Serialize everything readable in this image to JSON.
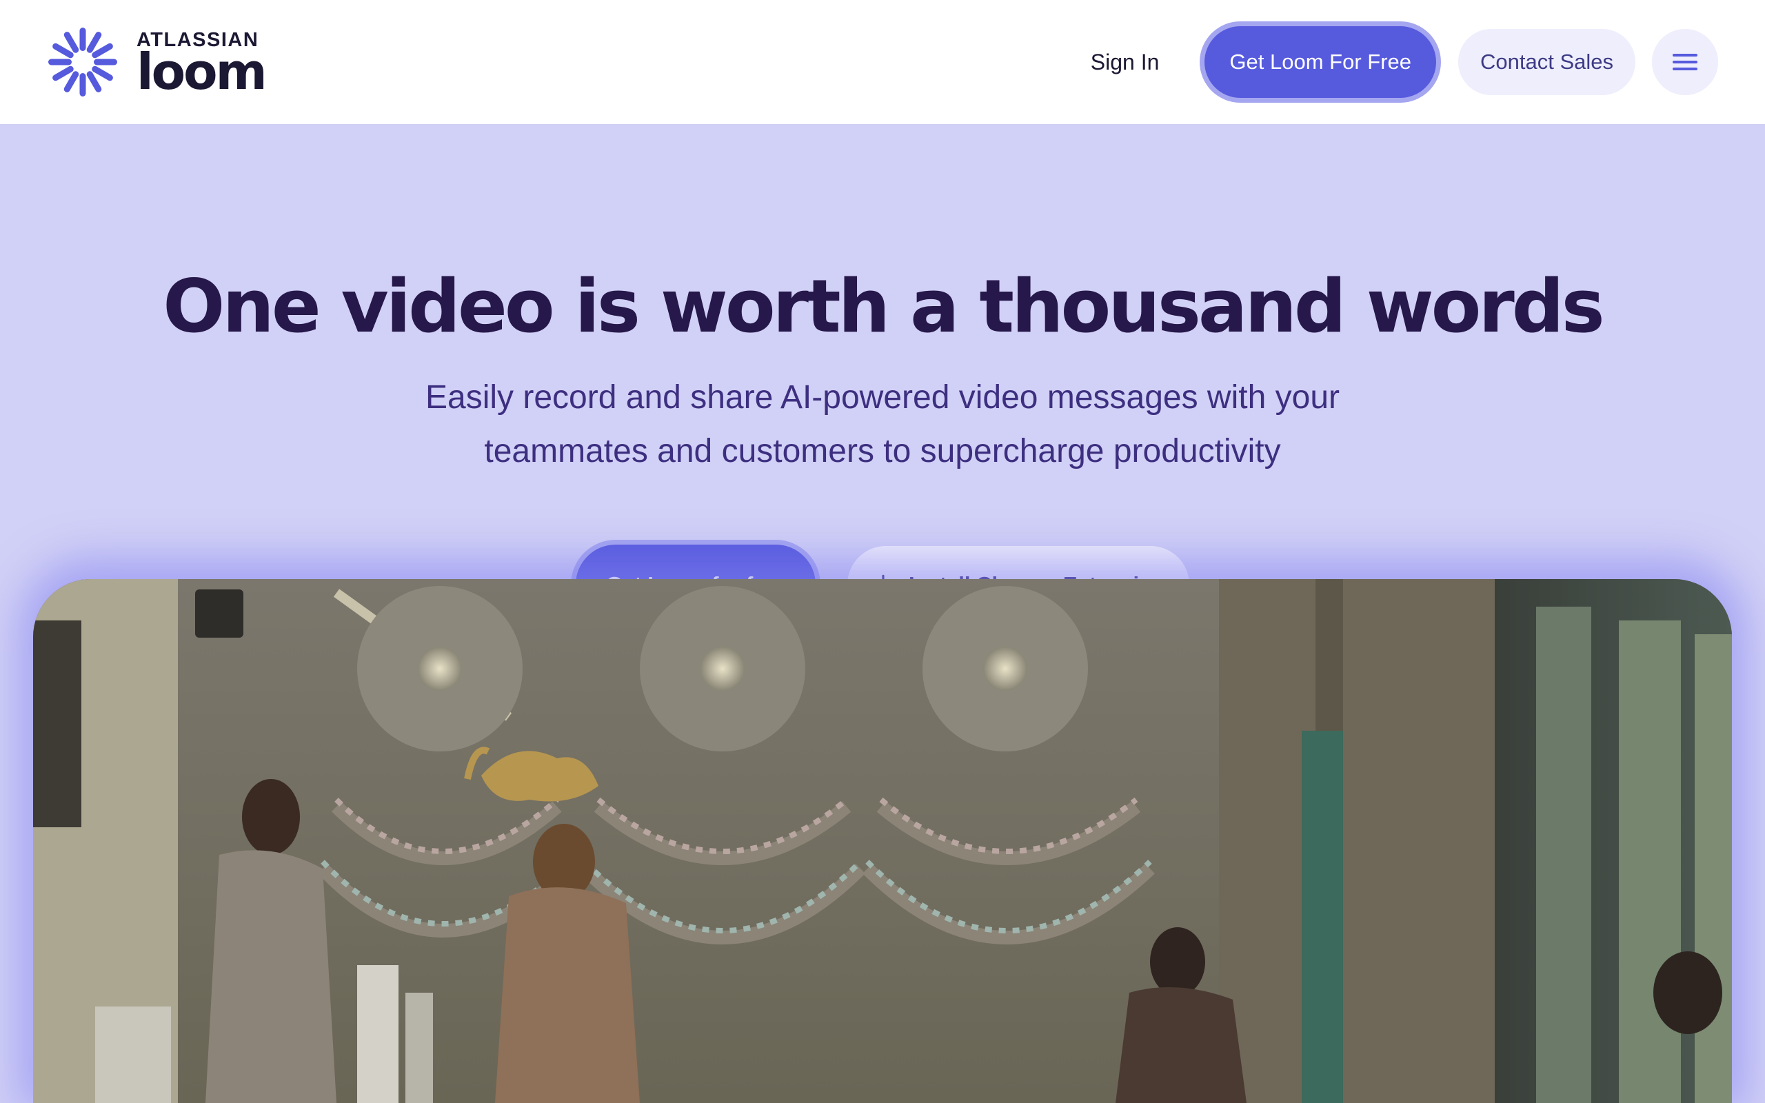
{
  "header": {
    "logo_brand": "ATLASSIAN",
    "logo_product": "loom",
    "sign_in": "Sign In",
    "cta_primary": "Get Loom For Free",
    "contact_sales": "Contact Sales",
    "menu_icon": "hamburger-menu-icon"
  },
  "hero": {
    "title": "One video is worth a thousand words",
    "subtitle": "Easily record and share AI-powered video messages with your teammates and customers to supercharge productivity",
    "cta_primary": "Get Loom for free",
    "cta_secondary": "Install Chrome Extension",
    "cta_secondary_icon": "download-icon"
  },
  "colors": {
    "brand": "#565add",
    "brand_ring": "#a5a6f0",
    "hero_bg": "#d1d0f6",
    "title": "#26184a",
    "subtitle": "#3d2f80",
    "pill_bg": "#eeeefc"
  }
}
